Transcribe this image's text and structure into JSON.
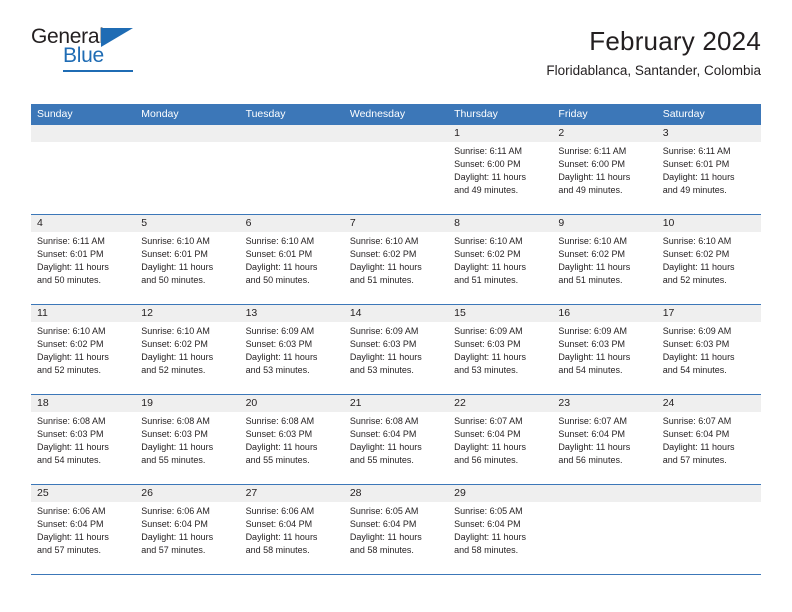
{
  "brand": {
    "name_top": "General",
    "name_bottom": "Blue",
    "accent_color": "#1f6cb4"
  },
  "header": {
    "title": "February 2024",
    "location": "Floridablanca, Santander, Colombia"
  },
  "calendar": {
    "header_color": "#3c77b8",
    "day_band_color": "#efefef",
    "weekdays": [
      "Sunday",
      "Monday",
      "Tuesday",
      "Wednesday",
      "Thursday",
      "Friday",
      "Saturday"
    ],
    "weeks": [
      [
        {
          "day": "",
          "sunrise": "",
          "sunset": "",
          "daylight_line1": "",
          "daylight_line2": ""
        },
        {
          "day": "",
          "sunrise": "",
          "sunset": "",
          "daylight_line1": "",
          "daylight_line2": ""
        },
        {
          "day": "",
          "sunrise": "",
          "sunset": "",
          "daylight_line1": "",
          "daylight_line2": ""
        },
        {
          "day": "",
          "sunrise": "",
          "sunset": "",
          "daylight_line1": "",
          "daylight_line2": ""
        },
        {
          "day": "1",
          "sunrise": "Sunrise: 6:11 AM",
          "sunset": "Sunset: 6:00 PM",
          "daylight_line1": "Daylight: 11 hours",
          "daylight_line2": "and 49 minutes."
        },
        {
          "day": "2",
          "sunrise": "Sunrise: 6:11 AM",
          "sunset": "Sunset: 6:00 PM",
          "daylight_line1": "Daylight: 11 hours",
          "daylight_line2": "and 49 minutes."
        },
        {
          "day": "3",
          "sunrise": "Sunrise: 6:11 AM",
          "sunset": "Sunset: 6:01 PM",
          "daylight_line1": "Daylight: 11 hours",
          "daylight_line2": "and 49 minutes."
        }
      ],
      [
        {
          "day": "4",
          "sunrise": "Sunrise: 6:11 AM",
          "sunset": "Sunset: 6:01 PM",
          "daylight_line1": "Daylight: 11 hours",
          "daylight_line2": "and 50 minutes."
        },
        {
          "day": "5",
          "sunrise": "Sunrise: 6:10 AM",
          "sunset": "Sunset: 6:01 PM",
          "daylight_line1": "Daylight: 11 hours",
          "daylight_line2": "and 50 minutes."
        },
        {
          "day": "6",
          "sunrise": "Sunrise: 6:10 AM",
          "sunset": "Sunset: 6:01 PM",
          "daylight_line1": "Daylight: 11 hours",
          "daylight_line2": "and 50 minutes."
        },
        {
          "day": "7",
          "sunrise": "Sunrise: 6:10 AM",
          "sunset": "Sunset: 6:02 PM",
          "daylight_line1": "Daylight: 11 hours",
          "daylight_line2": "and 51 minutes."
        },
        {
          "day": "8",
          "sunrise": "Sunrise: 6:10 AM",
          "sunset": "Sunset: 6:02 PM",
          "daylight_line1": "Daylight: 11 hours",
          "daylight_line2": "and 51 minutes."
        },
        {
          "day": "9",
          "sunrise": "Sunrise: 6:10 AM",
          "sunset": "Sunset: 6:02 PM",
          "daylight_line1": "Daylight: 11 hours",
          "daylight_line2": "and 51 minutes."
        },
        {
          "day": "10",
          "sunrise": "Sunrise: 6:10 AM",
          "sunset": "Sunset: 6:02 PM",
          "daylight_line1": "Daylight: 11 hours",
          "daylight_line2": "and 52 minutes."
        }
      ],
      [
        {
          "day": "11",
          "sunrise": "Sunrise: 6:10 AM",
          "sunset": "Sunset: 6:02 PM",
          "daylight_line1": "Daylight: 11 hours",
          "daylight_line2": "and 52 minutes."
        },
        {
          "day": "12",
          "sunrise": "Sunrise: 6:10 AM",
          "sunset": "Sunset: 6:02 PM",
          "daylight_line1": "Daylight: 11 hours",
          "daylight_line2": "and 52 minutes."
        },
        {
          "day": "13",
          "sunrise": "Sunrise: 6:09 AM",
          "sunset": "Sunset: 6:03 PM",
          "daylight_line1": "Daylight: 11 hours",
          "daylight_line2": "and 53 minutes."
        },
        {
          "day": "14",
          "sunrise": "Sunrise: 6:09 AM",
          "sunset": "Sunset: 6:03 PM",
          "daylight_line1": "Daylight: 11 hours",
          "daylight_line2": "and 53 minutes."
        },
        {
          "day": "15",
          "sunrise": "Sunrise: 6:09 AM",
          "sunset": "Sunset: 6:03 PM",
          "daylight_line1": "Daylight: 11 hours",
          "daylight_line2": "and 53 minutes."
        },
        {
          "day": "16",
          "sunrise": "Sunrise: 6:09 AM",
          "sunset": "Sunset: 6:03 PM",
          "daylight_line1": "Daylight: 11 hours",
          "daylight_line2": "and 54 minutes."
        },
        {
          "day": "17",
          "sunrise": "Sunrise: 6:09 AM",
          "sunset": "Sunset: 6:03 PM",
          "daylight_line1": "Daylight: 11 hours",
          "daylight_line2": "and 54 minutes."
        }
      ],
      [
        {
          "day": "18",
          "sunrise": "Sunrise: 6:08 AM",
          "sunset": "Sunset: 6:03 PM",
          "daylight_line1": "Daylight: 11 hours",
          "daylight_line2": "and 54 minutes."
        },
        {
          "day": "19",
          "sunrise": "Sunrise: 6:08 AM",
          "sunset": "Sunset: 6:03 PM",
          "daylight_line1": "Daylight: 11 hours",
          "daylight_line2": "and 55 minutes."
        },
        {
          "day": "20",
          "sunrise": "Sunrise: 6:08 AM",
          "sunset": "Sunset: 6:03 PM",
          "daylight_line1": "Daylight: 11 hours",
          "daylight_line2": "and 55 minutes."
        },
        {
          "day": "21",
          "sunrise": "Sunrise: 6:08 AM",
          "sunset": "Sunset: 6:04 PM",
          "daylight_line1": "Daylight: 11 hours",
          "daylight_line2": "and 55 minutes."
        },
        {
          "day": "22",
          "sunrise": "Sunrise: 6:07 AM",
          "sunset": "Sunset: 6:04 PM",
          "daylight_line1": "Daylight: 11 hours",
          "daylight_line2": "and 56 minutes."
        },
        {
          "day": "23",
          "sunrise": "Sunrise: 6:07 AM",
          "sunset": "Sunset: 6:04 PM",
          "daylight_line1": "Daylight: 11 hours",
          "daylight_line2": "and 56 minutes."
        },
        {
          "day": "24",
          "sunrise": "Sunrise: 6:07 AM",
          "sunset": "Sunset: 6:04 PM",
          "daylight_line1": "Daylight: 11 hours",
          "daylight_line2": "and 57 minutes."
        }
      ],
      [
        {
          "day": "25",
          "sunrise": "Sunrise: 6:06 AM",
          "sunset": "Sunset: 6:04 PM",
          "daylight_line1": "Daylight: 11 hours",
          "daylight_line2": "and 57 minutes."
        },
        {
          "day": "26",
          "sunrise": "Sunrise: 6:06 AM",
          "sunset": "Sunset: 6:04 PM",
          "daylight_line1": "Daylight: 11 hours",
          "daylight_line2": "and 57 minutes."
        },
        {
          "day": "27",
          "sunrise": "Sunrise: 6:06 AM",
          "sunset": "Sunset: 6:04 PM",
          "daylight_line1": "Daylight: 11 hours",
          "daylight_line2": "and 58 minutes."
        },
        {
          "day": "28",
          "sunrise": "Sunrise: 6:05 AM",
          "sunset": "Sunset: 6:04 PM",
          "daylight_line1": "Daylight: 11 hours",
          "daylight_line2": "and 58 minutes."
        },
        {
          "day": "29",
          "sunrise": "Sunrise: 6:05 AM",
          "sunset": "Sunset: 6:04 PM",
          "daylight_line1": "Daylight: 11 hours",
          "daylight_line2": "and 58 minutes."
        },
        {
          "day": "",
          "sunrise": "",
          "sunset": "",
          "daylight_line1": "",
          "daylight_line2": ""
        },
        {
          "day": "",
          "sunrise": "",
          "sunset": "",
          "daylight_line1": "",
          "daylight_line2": ""
        }
      ]
    ]
  }
}
